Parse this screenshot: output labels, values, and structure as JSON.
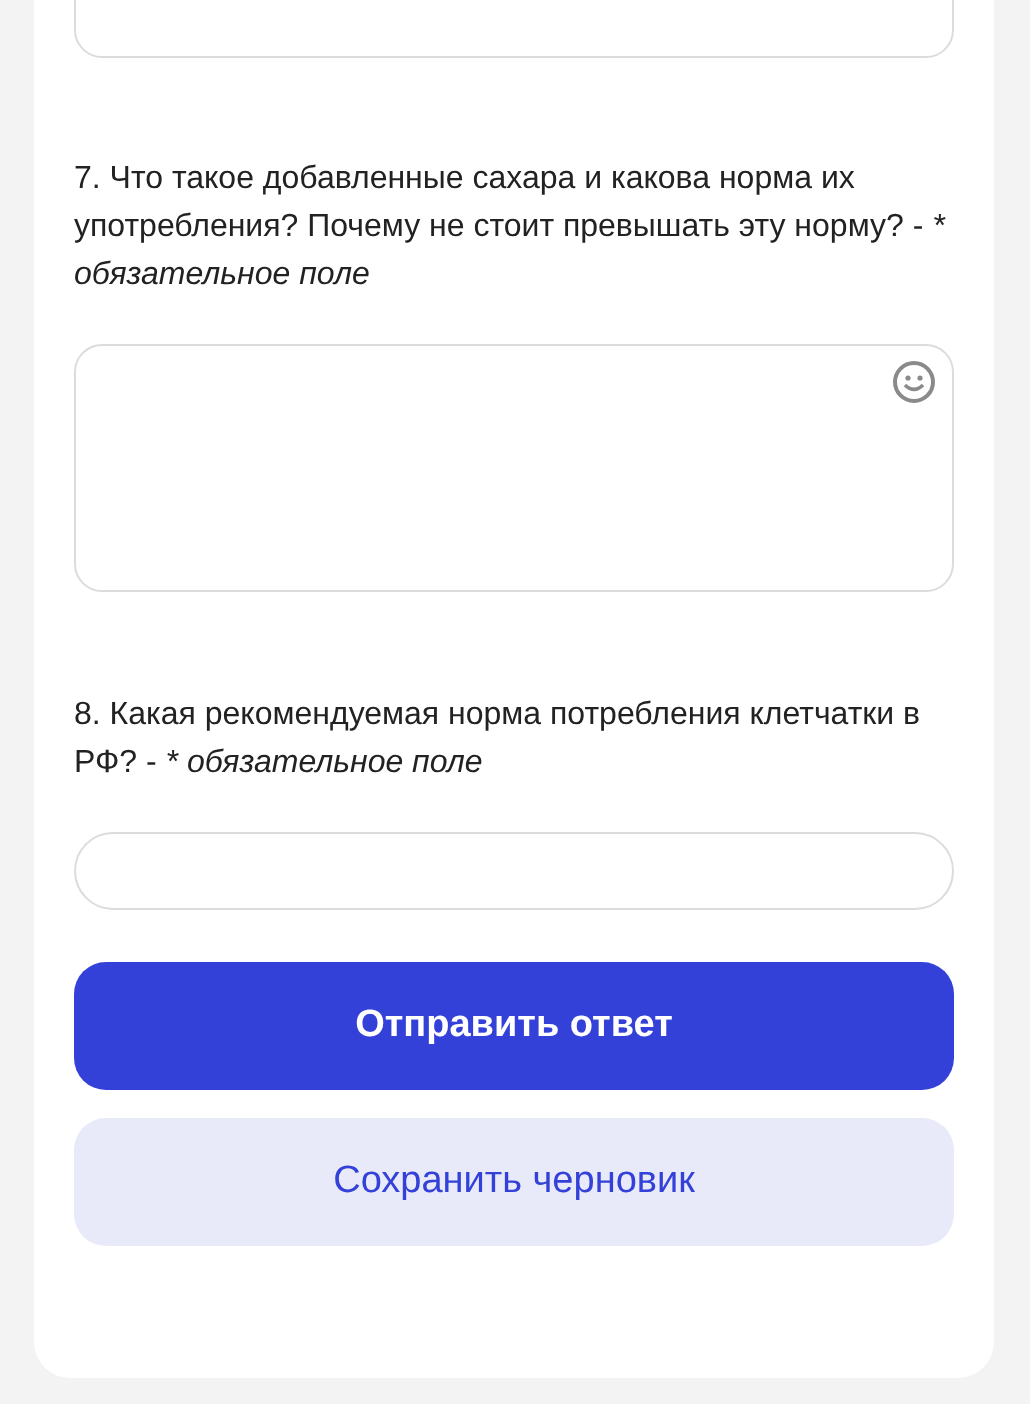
{
  "questions": [
    {
      "kind": "textarea",
      "text": "7. Что такое добавленные сахара и какова норма их употребления? Почему не стоит превышать эту норму? - ",
      "required_note": "* обязательное поле"
    },
    {
      "kind": "input",
      "text": "8. Какая рекомендуемая норма потребления клетчатки в РФ? - ",
      "required_note": "* обязательное поле"
    }
  ],
  "buttons": [
    {
      "kind": "primary",
      "label": "Отправить ответ"
    },
    {
      "kind": "secondary",
      "label": "Сохранить черновик"
    }
  ]
}
